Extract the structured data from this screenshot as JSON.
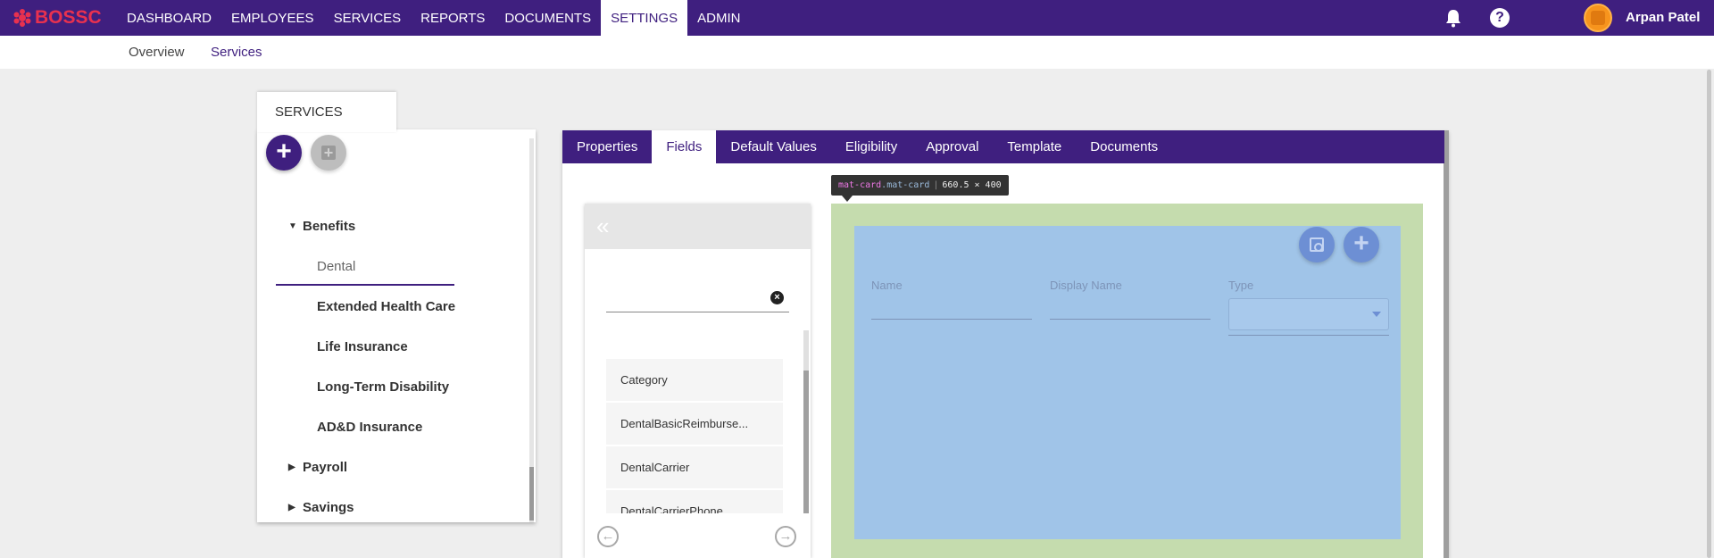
{
  "brand": {
    "name": "BOSSC",
    "color": "#e8314f"
  },
  "theme": {
    "primary": "#3f1f7f",
    "card_outer": "#c5dcae",
    "card_inner": "#a0c4e8"
  },
  "nav": {
    "items": [
      "DASHBOARD",
      "EMPLOYEES",
      "SERVICES",
      "REPORTS",
      "DOCUMENTS",
      "SETTINGS",
      "ADMIN"
    ],
    "active": "SETTINGS"
  },
  "user": {
    "name": "Arpan Patel",
    "icons": [
      "bell-icon",
      "help-icon"
    ]
  },
  "subnav": {
    "overview": "Overview",
    "services": "Services"
  },
  "services_panel": {
    "title": "SERVICES",
    "groups": {
      "benefits": {
        "label": "Benefits",
        "items": [
          "Dental",
          "Extended Health Care",
          "Life Insurance",
          "Long-Term Disability",
          "AD&D Insurance"
        ],
        "selected": "Dental"
      },
      "payroll": {
        "label": "Payroll"
      },
      "savings": {
        "label": "Savings"
      }
    }
  },
  "tabs": [
    "Properties",
    "Fields",
    "Default Values",
    "Eligibility",
    "Approval",
    "Template",
    "Documents"
  ],
  "active_tab": "Fields",
  "fields_list": {
    "search_value": "",
    "items": [
      "Category",
      "DentalBasicReimburse...",
      "DentalCarrier",
      "DentalCarrierPhone"
    ]
  },
  "devtools_tooltip": {
    "selector_a": "mat-card",
    "selector_b": ".mat-card",
    "size": "660.5 × 400"
  },
  "field_editor": {
    "name_label": "Name",
    "display_name_label": "Display Name",
    "type_label": "Type",
    "type_value": ""
  }
}
